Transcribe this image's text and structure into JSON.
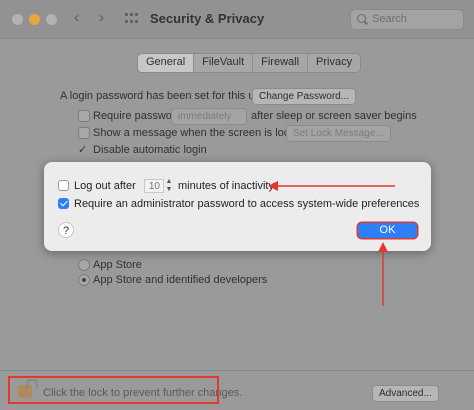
{
  "window": {
    "title": "Security & Privacy",
    "search_placeholder": "Search",
    "back_glyph": "‹",
    "forward_glyph": "›"
  },
  "tabs": [
    {
      "label": "General",
      "selected": true
    },
    {
      "label": "FileVault",
      "selected": false
    },
    {
      "label": "Firewall",
      "selected": false
    },
    {
      "label": "Privacy",
      "selected": false
    }
  ],
  "general": {
    "login_password_text": "A login password has been set for this user",
    "change_password_label": "Change Password...",
    "require_password_label": "Require password",
    "require_password_value": "immediately",
    "require_password_suffix": "after sleep or screen saver begins",
    "show_message_label": "Show a message when the screen is locked",
    "set_lock_message_label": "Set Lock Message...",
    "disable_auto_login_label": "Disable automatic login",
    "app_store_label": "App Store",
    "app_store_devs_label": "App Store and identified developers"
  },
  "footer": {
    "lock_text": "Click the lock to prevent further changes.",
    "advanced_label": "Advanced..."
  },
  "dialog": {
    "logout_prefix": "Log out after",
    "logout_minutes": "10",
    "logout_suffix": "minutes of inactivity",
    "require_admin_label": "Require an administrator password to access system-wide preferences",
    "help_label": "?",
    "ok_label": "OK"
  },
  "colors": {
    "accent_blue": "#2f7ff6",
    "annotation_red": "#e03a2e"
  }
}
